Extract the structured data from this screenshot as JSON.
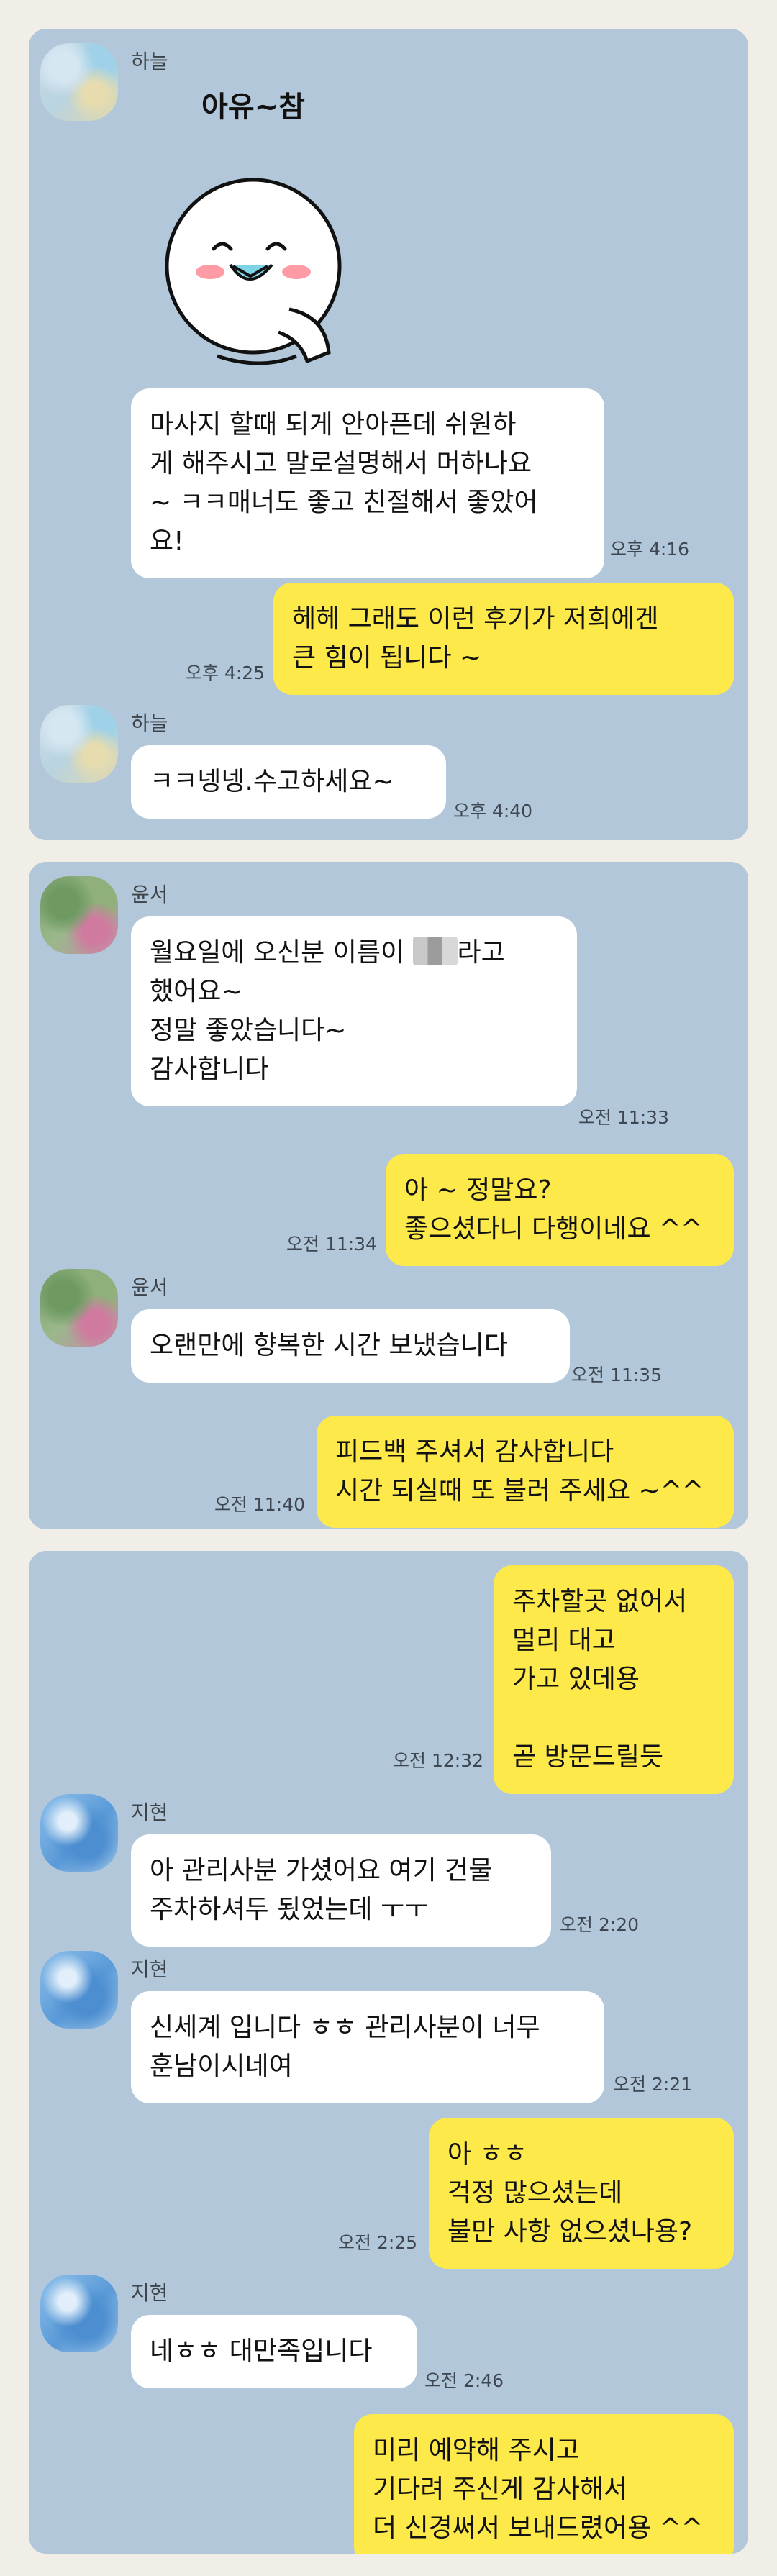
{
  "panel1": {
    "sender": "하늘",
    "sticker_text": "아유~참",
    "msg1": "마사지 할때 되게 안아픈데 쉬원하\n게 해주시고 말로설명해서 머하나요\n~ ㅋㅋ매너도 좋고 친절해서 좋았어\n요!",
    "time1": "오후 4:16",
    "reply1": "헤헤 그래도 이런 후기가 저희에겐\n큰 힘이 됩니다 ~",
    "reply1_time": "오후 4:25",
    "sender2": "하늘",
    "msg2": "ㅋㅋ넹넹.수고하세요~",
    "time2": "오후 4:40"
  },
  "panel2": {
    "sender": "윤서",
    "msg1_a": "월요일에 오신분 이름이 ",
    "msg1_b": "라고\n했어요~\n정말 좋았습니다~\n감사합니다",
    "time1": "오전 11:33",
    "reply1": "아 ~ 정말요?\n좋으셨다니 다행이네요 ^^",
    "reply1_time": "오전 11:34",
    "sender2": "윤서",
    "msg2": "오랜만에 향복한 시간 보냈습니다",
    "time2": "오전 11:35",
    "reply2": "피드백 주셔서 감사합니다\n시간 되실때 또 불러 주세요 ~^^",
    "reply2_time": "오전 11:40"
  },
  "panel3": {
    "out1": "주차할곳 없어서\n멀리 대고\n가고 있데용\n\n곧 방문드릴듯",
    "out1_time": "오전 12:32",
    "sender1": "지현",
    "msg1": "아 관리사분 가셨어요 여기 건물\n주차하셔두 됬었는데 ㅜㅜ",
    "time1": "오전 2:20",
    "sender2": "지현",
    "msg2": "신세계 입니다 ㅎㅎ 관리사분이 너무\n훈남이시네여",
    "time2": "오전 2:21",
    "out2": "아 ㅎㅎ\n걱정 많으셨는데\n불만 사항 없으셨나용?",
    "out2_time": "오전 2:25",
    "sender3": "지현",
    "msg3": "네ㅎㅎ 대만족입니다",
    "time3": "오전 2:46",
    "out3": "미리 예약해 주시고\n기다려 주신게 감사해서\n더 신경써서 보내드렸어용 ^^"
  }
}
